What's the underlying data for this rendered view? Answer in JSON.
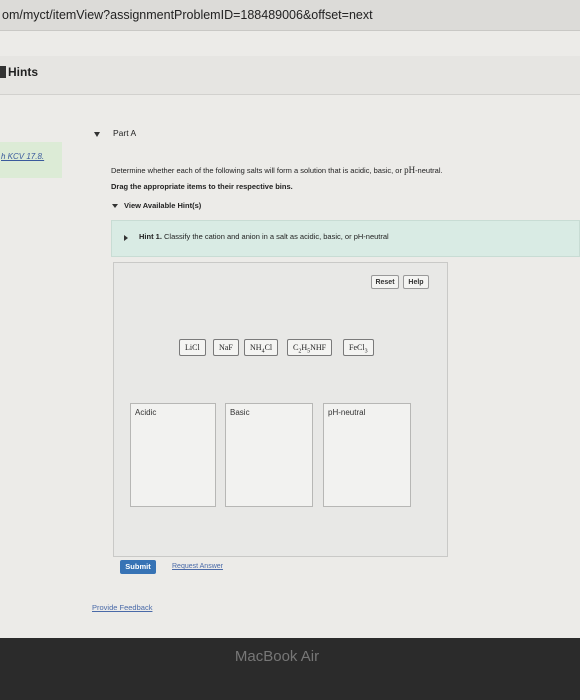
{
  "browser": {
    "url": "om/myct/itemView?assignmentProblemID=188489006&offset=next"
  },
  "hints_bar": {
    "label": "Hints"
  },
  "sidebar": {
    "item_label": "h KCV 17.8."
  },
  "part": {
    "label": "Part A"
  },
  "question": {
    "prefix": "Determine whether each of the following salts will form a solution that is acidic, basic, or ",
    "chem": "pH",
    "suffix": "-neutral.",
    "instruction": "Drag the appropriate items to their respective bins."
  },
  "view_hints": {
    "label": "View Available Hint(s)"
  },
  "hint1": {
    "prefix": "Hint 1.",
    "text": " Classify the cation and anion in a salt as acidic, basic, or pH-neutral"
  },
  "toolbar": {
    "reset_label": "Reset",
    "help_label": "Help"
  },
  "draggables": {
    "licl": "LiCl",
    "naf": "NaF",
    "nh4cl": "NH4Cl",
    "c2h5nhf": "C2H5NHF",
    "fecl3": "FeCl3"
  },
  "bins": {
    "acidic": "Acidic",
    "basic": "Basic",
    "neutral": "pH-neutral"
  },
  "actions": {
    "submit_label": "Submit",
    "request_answer_label": "Request Answer",
    "feedback_label": "Provide Feedback"
  },
  "device": {
    "brand": "MacBook Air"
  },
  "colors": {
    "submit_bg": "#3773b5",
    "hint_bg": "#d9ebe4",
    "sidebar_highlight": "#dcebd6",
    "link": "#4a6aa8"
  }
}
